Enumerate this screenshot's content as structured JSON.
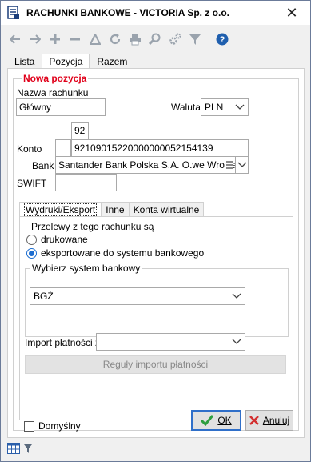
{
  "window": {
    "title": "RACHUNKI BANKOWE - VICTORIA Sp. z o.o."
  },
  "toolbar": {
    "icons": [
      "arrow-left-icon",
      "arrow-right-icon",
      "plus-icon",
      "minus-icon",
      "triangle-icon",
      "refresh-icon",
      "printer-icon",
      "zoom-icon",
      "settings-gear-icon",
      "filter-icon",
      "help-icon"
    ]
  },
  "tabs": [
    {
      "label": "Lista"
    },
    {
      "label": "Pozycja",
      "active": true
    },
    {
      "label": "Razem"
    }
  ],
  "form": {
    "group_title": "Nowa pozycja",
    "nazwa_label": "Nazwa rachunku",
    "nazwa_value": "Główny",
    "waluta_label": "Waluta",
    "waluta_value": "PLN",
    "konto_prefix": "92",
    "konto_label": "Konto",
    "konto_value": "92109015220000000052154139",
    "bank_label": "Bank",
    "bank_value": "Santander Bank Polska S.A. O.we Wrocławiu",
    "swift_label": "SWIFT",
    "swift_value": ""
  },
  "inner_tabs": [
    {
      "label": "Wydruki/Eksport",
      "active": true
    },
    {
      "label": "Inne"
    },
    {
      "label": "Konta wirtualne"
    }
  ],
  "przelewy": {
    "legend": "Przelewy z tego rachunku są",
    "options": [
      {
        "label": "drukowane",
        "checked": false
      },
      {
        "label": "eksportowane do systemu bankowego",
        "checked": true
      }
    ]
  },
  "system": {
    "legend": "Wybierz system bankowy",
    "value": "BGŻ"
  },
  "import": {
    "label": "Import płatności z",
    "value": "",
    "rules_button": "Reguły importu płatności"
  },
  "footer": {
    "domyslny_label": "Domyślny",
    "ok_label": "OK",
    "cancel_label": "Anuluj"
  },
  "colors": {
    "accent_red": "#e0001a",
    "ok_green": "#2e9e3f",
    "cancel_red": "#d32f2f",
    "focus_blue": "#2f6fc9"
  }
}
